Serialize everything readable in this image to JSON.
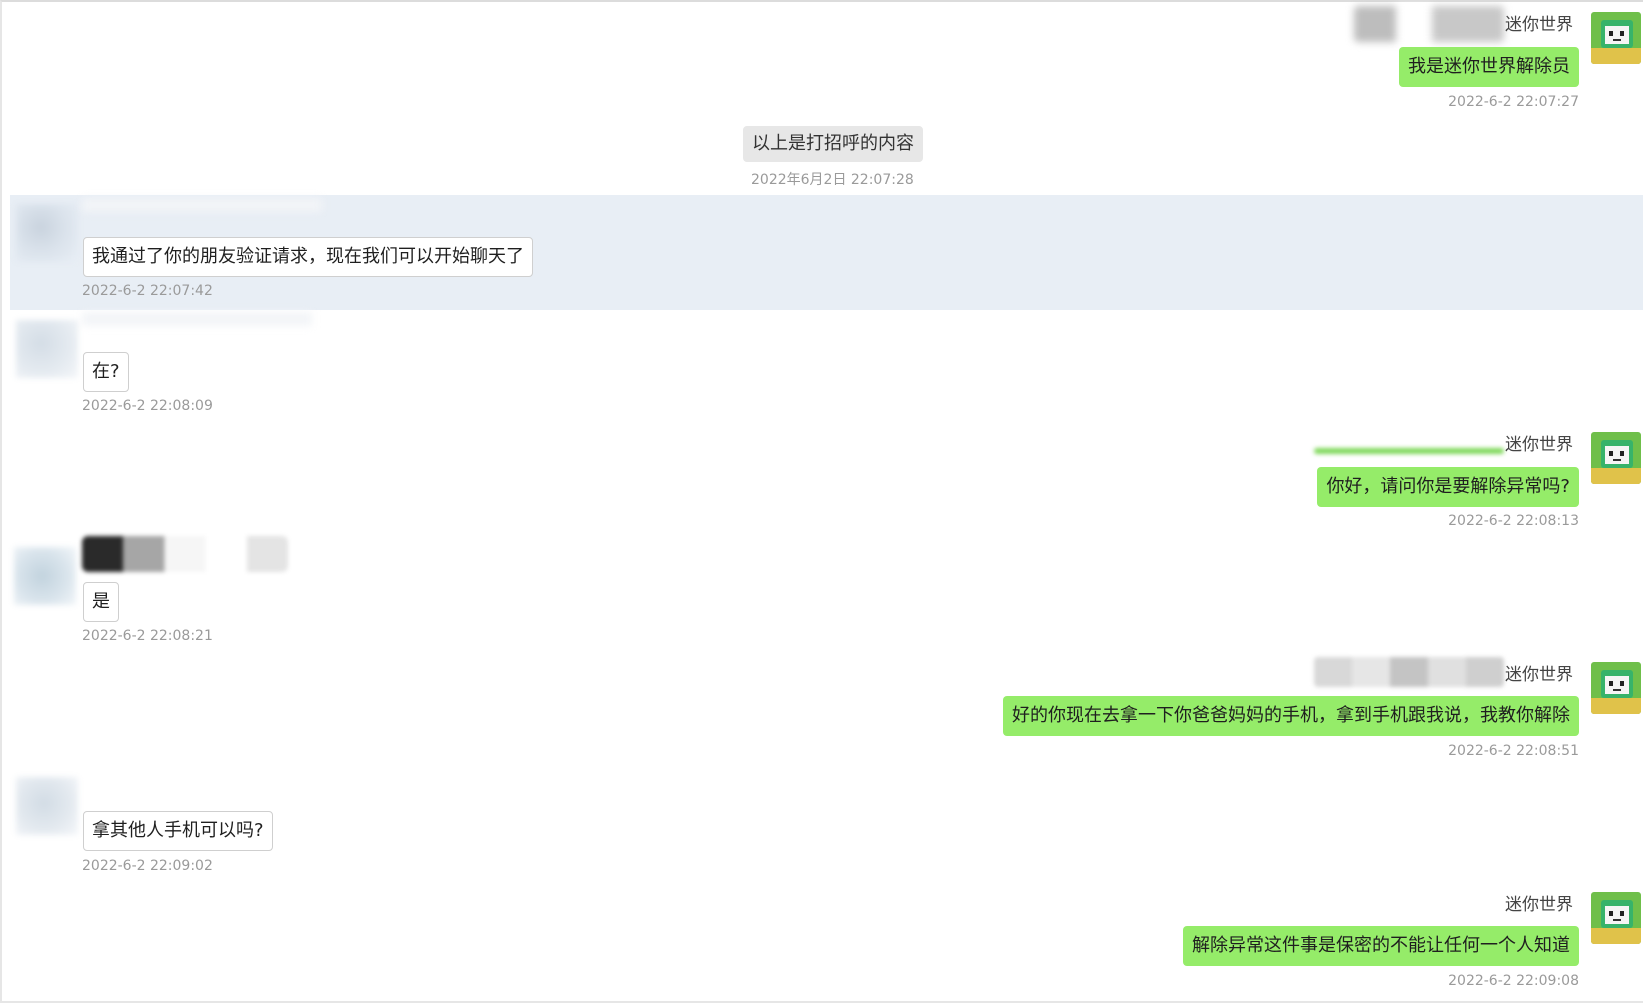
{
  "system": {
    "text": "以上是打招呼的内容",
    "time": "2022年6月2日 22:07:28"
  },
  "messages": [
    {
      "side": "right",
      "name": "迷你世界",
      "text": "我是迷你世界解除员",
      "time": "2022-6-2 22:07:27"
    },
    {
      "side": "left",
      "text": "我通过了你的朋友验证请求，现在我们可以开始聊天了",
      "time": "2022-6-2 22:07:42"
    },
    {
      "side": "left",
      "text": "在?",
      "time": "2022-6-2 22:08:09"
    },
    {
      "side": "right",
      "name": "迷你世界",
      "text": "你好，请问你是要解除异常吗?",
      "time": "2022-6-2 22:08:13"
    },
    {
      "side": "left",
      "text": "是",
      "time": "2022-6-2 22:08:21"
    },
    {
      "side": "right",
      "name": "迷你世界",
      "text": "好的你现在去拿一下你爸爸妈妈的手机，拿到手机跟我说，我教你解除",
      "time": "2022-6-2 22:08:51"
    },
    {
      "side": "left",
      "text": "拿其他人手机可以吗?",
      "time": "2022-6-2 22:09:02"
    },
    {
      "side": "right",
      "name": "迷你世界",
      "text": "解除异常这件事是保密的不能让任何一个人知道",
      "time": "2022-6-2 22:09:08"
    }
  ],
  "colors": {
    "self_bubble": "#95ec69",
    "other_bubble": "#ffffff",
    "highlight_row": "#e8eef5",
    "system_bubble": "#e7e7e7"
  },
  "icons": {
    "self_avatar": "mini-world-character-icon",
    "other_avatar": "blurred-avatar"
  }
}
